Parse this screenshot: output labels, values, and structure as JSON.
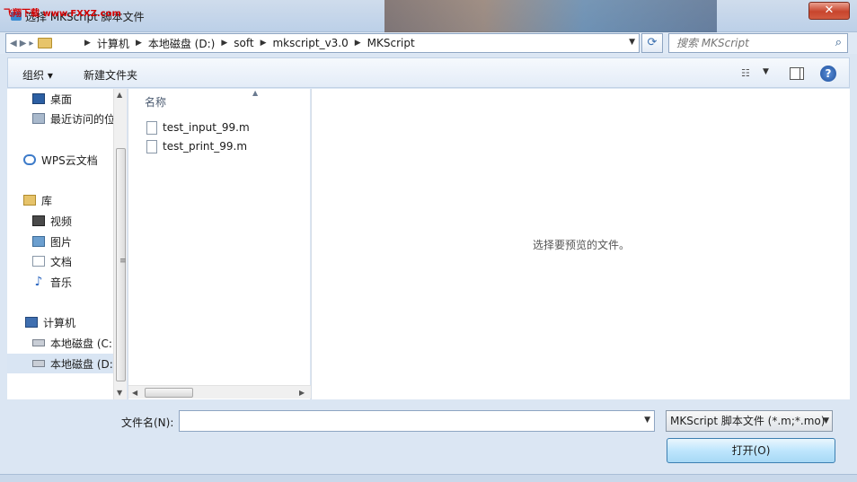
{
  "window": {
    "watermark": "飞翔下载 www.FXXZ.com",
    "title": "选择 MKScript 脚本文件",
    "close_glyph": "✕"
  },
  "address": {
    "crumbs": [
      "计算机",
      "本地磁盘 (D:)",
      "soft",
      "mkscript_v3.0",
      "MKScript"
    ],
    "search_placeholder": "搜索 MKScript"
  },
  "toolbar": {
    "organize_label": "组织 ▾",
    "new_folder_label": "新建文件夹"
  },
  "nav": {
    "items": [
      {
        "label": "桌面",
        "icon": "desktop-icon"
      },
      {
        "label": "最近访问的位置",
        "icon": "recent-icon"
      },
      {
        "label": "WPS云文档",
        "icon": "cloud-icon"
      },
      {
        "label": "库",
        "icon": "library-icon"
      },
      {
        "label": "视频",
        "icon": "video-icon"
      },
      {
        "label": "图片",
        "icon": "picture-icon"
      },
      {
        "label": "文档",
        "icon": "document-icon"
      },
      {
        "label": "音乐",
        "icon": "music-icon"
      },
      {
        "label": "计算机",
        "icon": "computer-icon"
      },
      {
        "label": "本地磁盘 (C:)",
        "icon": "drive-icon"
      },
      {
        "label": "本地磁盘 (D:)",
        "icon": "drive-icon",
        "selected": true
      }
    ]
  },
  "files": {
    "column_name": "名称",
    "items": [
      "test_input_99.m",
      "test_print_99.m"
    ]
  },
  "preview": {
    "message": "选择要预览的文件。"
  },
  "bottom": {
    "filename_label": "文件名(N):",
    "filename_value": "",
    "filetype_value": "MKScript 脚本文件 (*.m;*.mo)",
    "open_button_label": "打开(O)"
  }
}
